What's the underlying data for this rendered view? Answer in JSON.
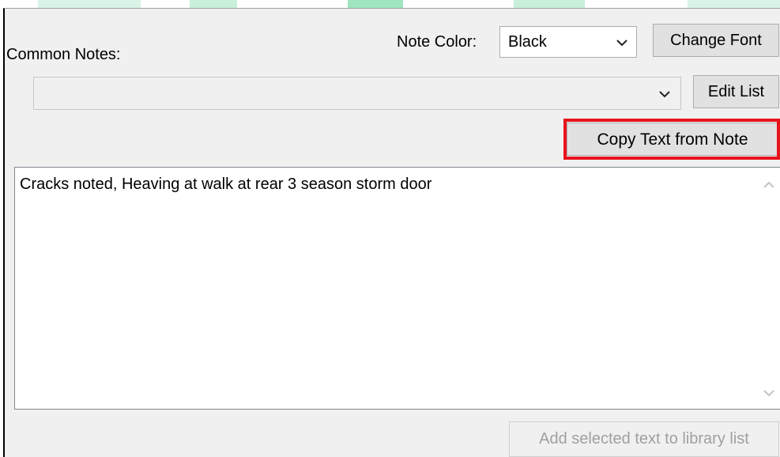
{
  "header": {
    "common_notes_label": "Common Notes:",
    "note_color_label": "Note Color:",
    "note_color_value": "Black",
    "change_font_label": "Change Font"
  },
  "common_notes": {
    "selected_value": "",
    "edit_list_label": "Edit List"
  },
  "copy_text_button_label": "Copy Text from Note",
  "note_text": "Cracks noted, Heaving at walk at rear 3 season storm door",
  "add_selected_button_label": "Add selected text to library list",
  "colors": {
    "highlight": "#e8131b",
    "panel_bg": "#f0f0f0",
    "button_bg": "#e1e1e1"
  }
}
